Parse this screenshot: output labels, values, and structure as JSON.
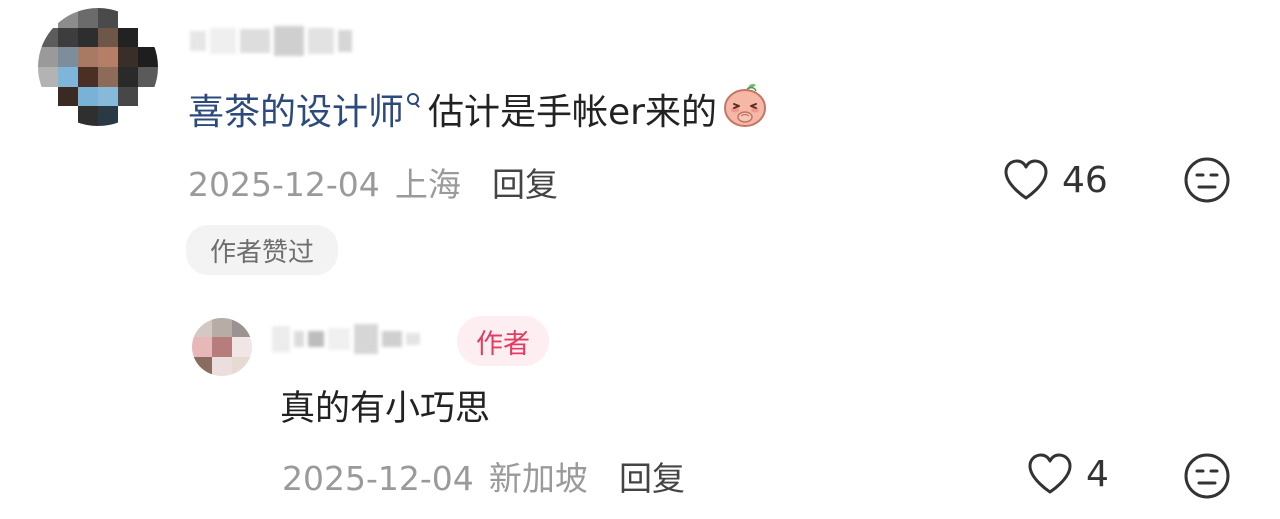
{
  "comment": {
    "mention": "喜茶的设计师",
    "text": "估计是手帐er来的",
    "date": "2025-12-04",
    "location": "上海",
    "reply_label": "回复",
    "likes": "46",
    "badge": "作者赞过",
    "emoji_icon": "shy-peach-emoji-icon"
  },
  "reply": {
    "author_tag": "作者",
    "text": "真的有小巧思",
    "date": "2025-12-04",
    "location": "新加坡",
    "reply_label": "回复",
    "likes": "4"
  },
  "colors": {
    "mention": "#2c4a7c",
    "meta": "#9a9a9a",
    "author_tag_text": "#e43b63",
    "author_tag_bg": "#fdeef1",
    "badge_bg": "#f3f3f3"
  }
}
